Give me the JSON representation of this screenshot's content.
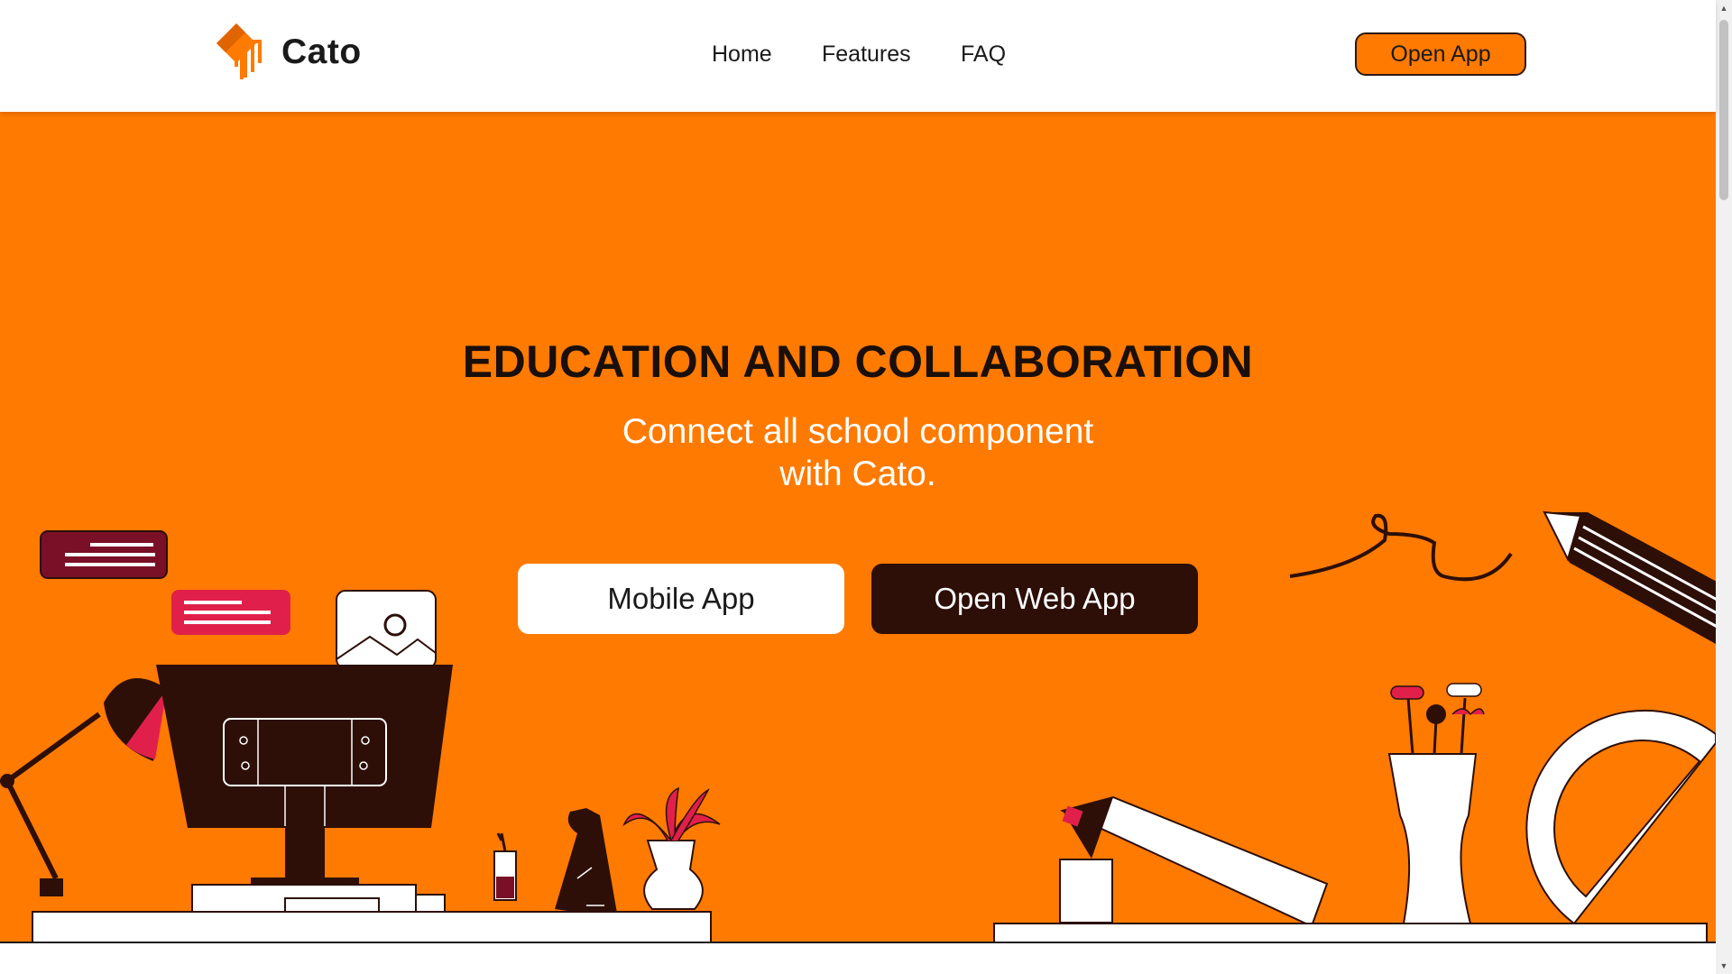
{
  "header": {
    "brand": "Cato",
    "nav": [
      "Home",
      "Features",
      "FAQ"
    ],
    "open_app_label": "Open App"
  },
  "hero": {
    "title": "EDUCATION AND COLLABORATION",
    "subtitle_line1": "Connect all school component",
    "subtitle_line2": "with Cato.",
    "mobile_button": "Mobile App",
    "web_button": "Open Web App"
  },
  "colors": {
    "accent": "#ff7a00",
    "dark": "#2d0f08",
    "crimson": "#e0204a",
    "maroon": "#7a1027"
  },
  "icons": [
    "cato-logo-icon",
    "chevron-up-icon",
    "chevron-down-icon"
  ]
}
